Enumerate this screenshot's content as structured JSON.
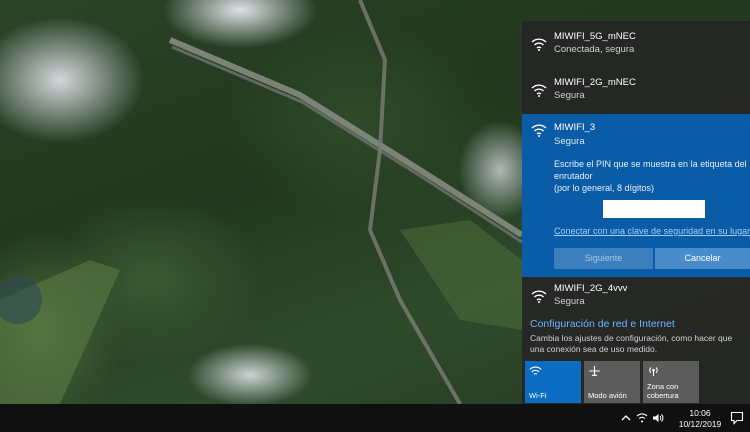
{
  "networks": [
    {
      "ssid": "MIWIFI_5G_mNEC",
      "status": "Conectada, segura"
    },
    {
      "ssid": "MIWIFI_2G_mNEC",
      "status": "Segura"
    },
    {
      "ssid": "MIWIFI_3",
      "status": "Segura"
    },
    {
      "ssid": "MIWIFI_2G_4vvv",
      "status": "Segura"
    }
  ],
  "pin_prompt": {
    "line1": "Escribe el PIN que se muestra en la etiqueta del",
    "line2": "enrutador",
    "line3": "(por lo general, 8 dígitos)",
    "pin_value": "",
    "alt_link": "Conectar con una clave de seguridad en su lugar",
    "next_label": "Siguiente",
    "cancel_label": "Cancelar"
  },
  "settings": {
    "link": "Configuración de red e Internet",
    "description": "Cambia los ajustes de configuración, como hacer que una conexión sea de uso medido."
  },
  "quick_actions": [
    {
      "label": "Wi-Fi",
      "icon": "wifi-icon",
      "active": true
    },
    {
      "label": "Modo avión",
      "icon": "airplane-icon",
      "active": false
    },
    {
      "label": "Zona con cobertura",
      "icon": "hotspot-icon",
      "active": false
    }
  ],
  "taskbar": {
    "time": "10:06",
    "date": "10/12/2019",
    "tray_icons": [
      "chevron-up-icon",
      "network-icon",
      "volume-icon"
    ],
    "notification_icon": "action-center-icon"
  },
  "colors": {
    "accent": "#0b5ca6",
    "tile_active": "#0b6cc4",
    "link": "#6ab7ff",
    "flyout_bg": "#262626",
    "taskbar_bg": "#101010"
  }
}
